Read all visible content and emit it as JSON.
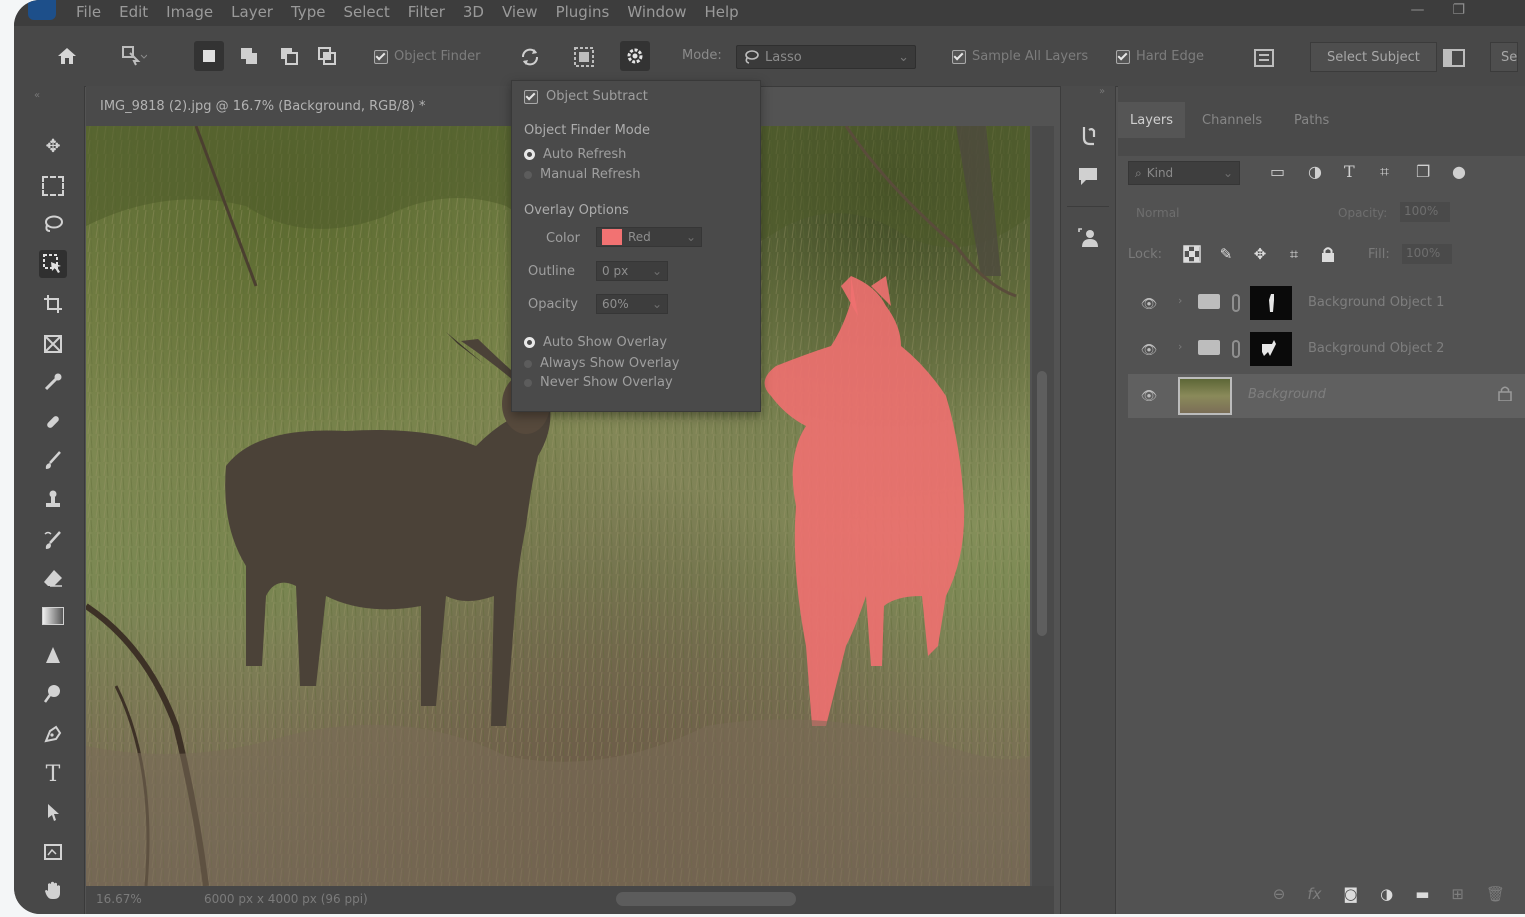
{
  "menubar": {
    "items": [
      "File",
      "Edit",
      "Image",
      "Layer",
      "Type",
      "Select",
      "Filter",
      "3D",
      "View",
      "Plugins",
      "Window",
      "Help"
    ],
    "minimize_glyph": "—",
    "maximize_glyph": "❐"
  },
  "options": {
    "object_finder_label": "Object Finder",
    "mode_label": "Mode:",
    "mode_value": "Lasso",
    "sample_all_layers_label": "Sample All Layers",
    "hard_edge_label": "Hard Edge",
    "select_subject_label": "Select Subject",
    "cut_label": "Se"
  },
  "document": {
    "tab_title": "IMG_9818 (2).jpg @ 16.7% (Background, RGB/8) *",
    "status_zoom": "16.67%",
    "status_info": "6000 px x 4000 px (96 ppi)"
  },
  "object_finder_popup": {
    "object_subtract_label": "Object Subtract",
    "mode_heading": "Object Finder Mode",
    "auto_refresh_label": "Auto Refresh",
    "manual_refresh_label": "Manual Refresh",
    "overlay_heading": "Overlay Options",
    "color_label": "Color",
    "color_value": "Red",
    "outline_label": "Outline",
    "outline_value": "0 px",
    "opacity_label": "Opacity",
    "opacity_value": "60%",
    "auto_show_label": "Auto Show Overlay",
    "always_show_label": "Always Show Overlay",
    "never_show_label": "Never Show Overlay",
    "overlay_color": "#f27272"
  },
  "layers_panel": {
    "tabs": [
      "Layers",
      "Channels",
      "Paths"
    ],
    "kind_label": "Kind",
    "blend_mode": "Normal",
    "opacity_label": "Opacity:",
    "opacity_value": "100%",
    "lock_label": "Lock:",
    "fill_label": "Fill:",
    "fill_value": "100%",
    "layers": [
      {
        "name": "Background Object 1"
      },
      {
        "name": "Background Object 2"
      },
      {
        "name": "Background"
      }
    ]
  }
}
